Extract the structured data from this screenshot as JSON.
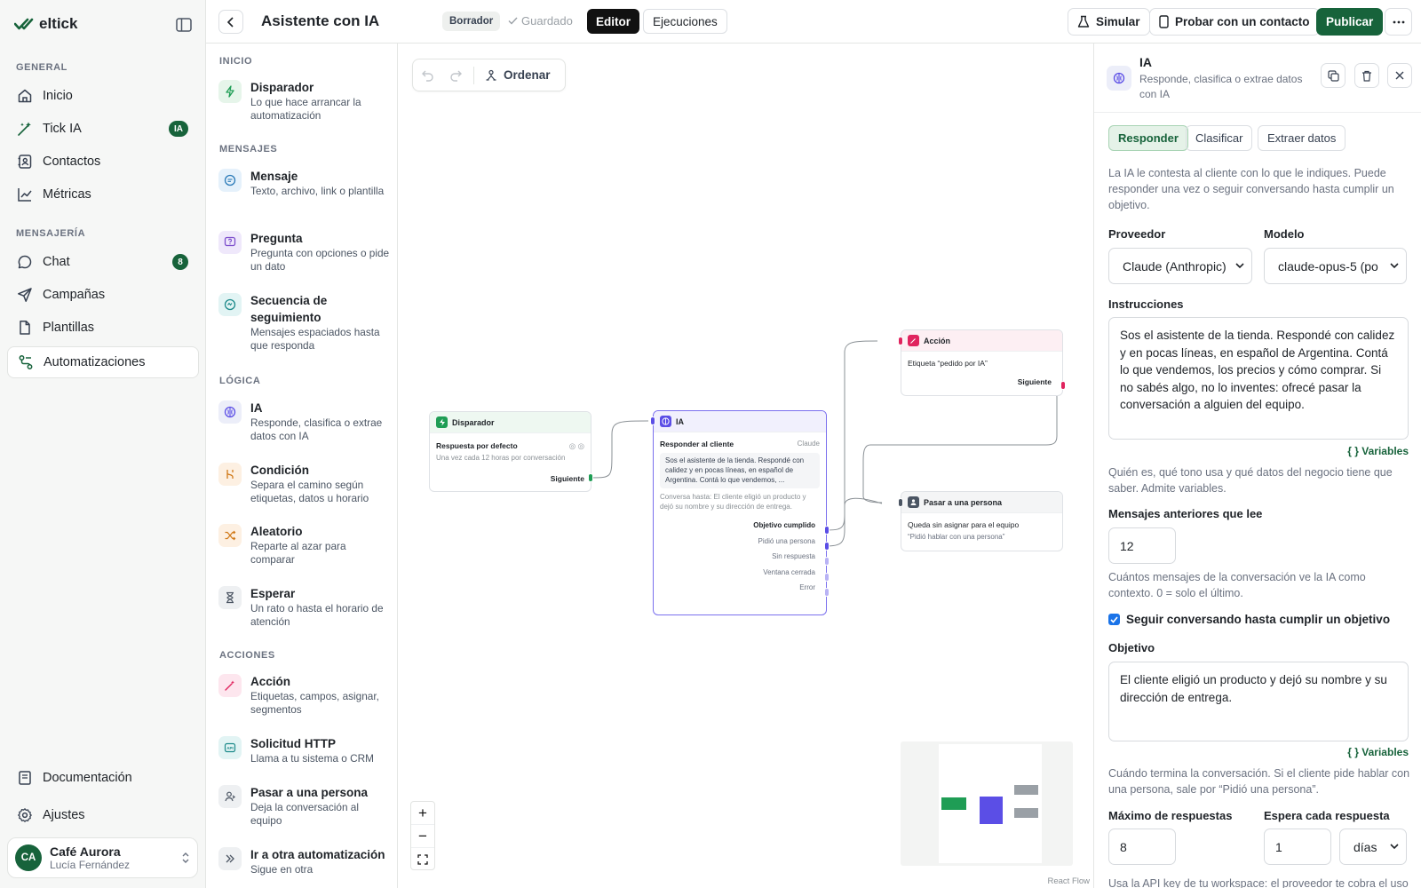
{
  "app": {
    "name": "eltick"
  },
  "sidebar": {
    "groups": {
      "general": "GENERAL",
      "messaging": "MENSAJERÍA"
    },
    "items": [
      {
        "label": "Inicio"
      },
      {
        "label": "Tick IA",
        "badge": "IA"
      },
      {
        "label": "Contactos"
      },
      {
        "label": "Métricas"
      },
      {
        "label": "Chat",
        "badge": "8"
      },
      {
        "label": "Campañas"
      },
      {
        "label": "Plantillas"
      },
      {
        "label": "Automatizaciones"
      },
      {
        "label": "Documentación"
      },
      {
        "label": "Ajustes"
      }
    ],
    "active": "Automatizaciones",
    "user": {
      "initials": "CA",
      "name": "Café Aurora",
      "person": "Lucía Fernández"
    }
  },
  "topbar": {
    "title": "Asistente con IA",
    "status": "Borrador",
    "saved": "Guardado",
    "editor": "Editor",
    "runs": "Ejecuciones",
    "simulate": "Simular",
    "test": "Probar con un contacto",
    "publish": "Publicar"
  },
  "palette": {
    "groups": {
      "start": "INICIO",
      "messages": "MENSAJES",
      "logic": "LÓGICA",
      "actions": "ACCIONES"
    },
    "items": [
      {
        "title": "Disparador",
        "desc": "Lo que hace arrancar la automatización"
      },
      {
        "title": "Mensaje",
        "desc": "Texto, archivo, link o plantilla"
      },
      {
        "title": "Pregunta",
        "desc": "Pregunta con opciones o pide un dato"
      },
      {
        "title": "Secuencia de seguimiento",
        "desc": "Mensajes espaciados hasta que responda"
      },
      {
        "title": "IA",
        "desc": "Responde, clasifica o extrae datos con IA"
      },
      {
        "title": "Condición",
        "desc": "Separa el camino según etiquetas, datos u horario"
      },
      {
        "title": "Aleatorio",
        "desc": "Reparte al azar para comparar"
      },
      {
        "title": "Esperar",
        "desc": "Un rato o hasta el horario de atención"
      },
      {
        "title": "Acción",
        "desc": "Etiquetas, campos, asignar, segmentos"
      },
      {
        "title": "Solicitud HTTP",
        "desc": "Llama a tu sistema o CRM"
      },
      {
        "title": "Pasar a una persona",
        "desc": "Deja la conversación al equipo"
      },
      {
        "title": "Ir a otra automatización",
        "desc": "Sigue en otra"
      }
    ]
  },
  "canvas": {
    "toolbar": {
      "arrange": "Ordenar"
    },
    "attribution": "React Flow",
    "nodes": {
      "trigger": {
        "title": "Disparador",
        "label": "Respuesta por defecto",
        "desc": "Una vez cada 12 horas por conversación",
        "next": "Siguiente"
      },
      "ai": {
        "title": "IA",
        "label": "Responder al cliente",
        "provider": "Claude",
        "preview": "Sos el asistente de la tienda. Respondé con calidez y en pocas líneas, en español de Argentina. Contá lo que vendemos, ...",
        "until": "Conversa hasta: El cliente eligió un producto y dejó su nombre y su dirección de entrega.",
        "outputs": [
          "Objetivo cumplido",
          "Pidió una persona",
          "Sin respuesta",
          "Ventana cerrada",
          "Error"
        ]
      },
      "action": {
        "title": "Acción",
        "label": "Etiqueta “pedido por IA”",
        "next": "Siguiente"
      },
      "handoff": {
        "title": "Pasar a una persona",
        "label": "Queda sin asignar para el equipo",
        "note": "“Pidió hablar con una persona”"
      }
    }
  },
  "panel": {
    "title": "IA",
    "desc": "Responde, clasifica o extrae datos con IA",
    "tabs": [
      "Responder",
      "Clasificar",
      "Extraer datos"
    ],
    "active_tab": "Responder",
    "intro": "La IA le contesta al cliente con lo que le indiques. Puede responder una vez o seguir conversando hasta cumplir un objetivo.",
    "provider_label": "Proveedor",
    "provider_value": "Claude (Anthropic)",
    "model_label": "Modelo",
    "model_value": "claude-opus-5 (po",
    "instructions_label": "Instrucciones",
    "instructions_value": "Sos el asistente de la tienda. Respondé con calidez y en pocas líneas, en español de Argentina. Contá lo que vendemos, los precios y cómo comprar. Si no sabés algo, no lo inventes: ofrecé pasar la conversación a alguien del equipo.",
    "variables": "{ } Variables",
    "instructions_hint": "Quién es, qué tono usa y qué datos del negocio tiene que saber. Admite variables.",
    "history_label": "Mensajes anteriores que lee",
    "history_value": "12",
    "history_hint": "Cuántos mensajes de la conversación ve la IA como contexto. 0 = solo el último.",
    "continue_label": "Seguir conversando hasta cumplir un objetivo",
    "continue_checked": true,
    "goal_label": "Objetivo",
    "goal_value": "El cliente eligió un producto y dejó su nombre y su dirección de entrega.",
    "goal_hint": "Cuándo termina la conversación. Si el cliente pide hablar con una persona, sale por “Pidió una persona”.",
    "max_label": "Máximo de respuestas",
    "max_value": "8",
    "wait_label": "Espera cada respuesta",
    "wait_value": "1",
    "wait_unit": "días",
    "footer_hint": "Usa la API key de tu workspace: el proveedor te cobra el uso"
  },
  "colors": {
    "brand": "#17633b",
    "ai": "#5b4ee6",
    "action": "#e0245e",
    "trigger": "#1f9d55"
  }
}
